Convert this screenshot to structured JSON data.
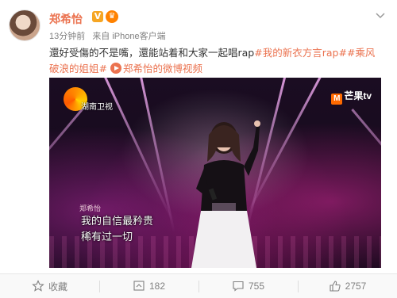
{
  "post": {
    "username": "郑希怡",
    "verified_badge": "V",
    "member_badge": "♛",
    "time": "13分钟前",
    "source": "来自 iPhone客户端",
    "text_plain": "還好受傷的不是嘴，還能站着和大家一起唱rap",
    "tag1": "#我的新衣方言rap#",
    "tag2": "#乘风破浪的姐姐#",
    "video_link_label": "郑希怡的微博视频"
  },
  "video": {
    "logo_left": "湖南卫视",
    "logo_right": "芒果tv",
    "logo_right_badge": "M",
    "caption_small": "郑希怡",
    "caption_line1": "我的自信最矜贵",
    "caption_line2": "稀有过一切"
  },
  "actions": {
    "favorite_label": "收藏",
    "repost_count": "182",
    "comment_count": "755",
    "like_count": "2757"
  },
  "colors": {
    "accent": "#eb7350",
    "muted": "#808080",
    "verified": "#f6a623"
  }
}
